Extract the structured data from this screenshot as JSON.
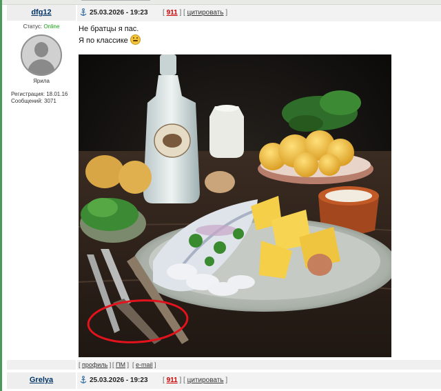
{
  "post1": {
    "author": "dfg12",
    "date": "25.03.2026 - 19:23",
    "post_number": "911",
    "quote_label": "цитировать",
    "status_label": "Статус:",
    "status_value": "Online",
    "role": "Ярила",
    "registration": "Регистрация: 18.01.16",
    "messages": "Сообщений: 3071",
    "text_line1": "Не братцы я пас.",
    "text_line2": "Я по классике",
    "footer": {
      "profile": "профиль",
      "pm": "ПМ",
      "email": "e-mail"
    }
  },
  "post2": {
    "author": "Grelya",
    "date": "25.03.2026 - 19:23",
    "post_number": "911",
    "quote_label": "цитировать"
  },
  "colors": {
    "accent": "#4a9a5c",
    "online": "#13a013",
    "post_number": "#cc0000",
    "annotation": "#e2131c"
  },
  "icons": [
    "anchor-icon",
    "avatar-placeholder",
    "smiley-icon"
  ]
}
